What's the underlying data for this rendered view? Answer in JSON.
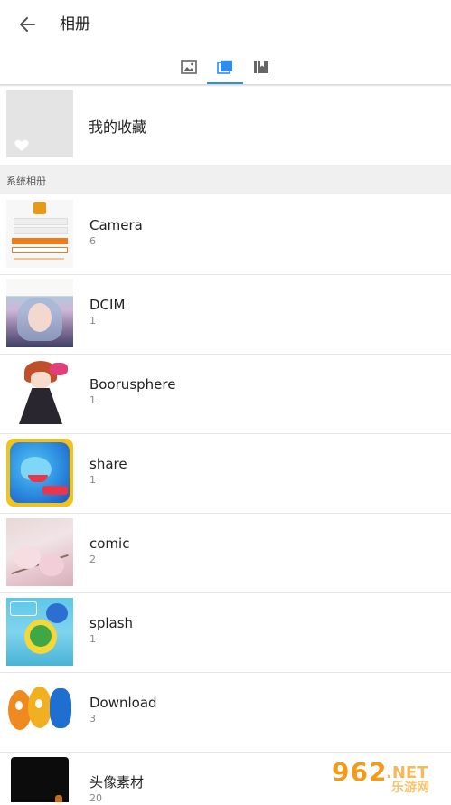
{
  "header": {
    "title": "相册"
  },
  "tabs": [
    {
      "icon": "image-icon",
      "active": false
    },
    {
      "icon": "album-icon",
      "active": true
    },
    {
      "icon": "bookmark-icon",
      "active": false
    }
  ],
  "favorites": {
    "label": "我的收藏"
  },
  "section": {
    "label": "系统相册"
  },
  "albums": [
    {
      "name": "Camera",
      "count": "6"
    },
    {
      "name": "DCIM",
      "count": "1"
    },
    {
      "name": "Boorusphere",
      "count": "1"
    },
    {
      "name": "share",
      "count": "1"
    },
    {
      "name": "comic",
      "count": "2"
    },
    {
      "name": "splash",
      "count": "1"
    },
    {
      "name": "Download",
      "count": "3"
    },
    {
      "name": "头像素材",
      "count": "20"
    }
  ],
  "watermark": {
    "main": "962",
    "net": ".NET",
    "sub": "乐游网"
  },
  "colors": {
    "accent": "#2d8cf0",
    "tab_inactive": "#666666",
    "section_bg": "#f0f0f0"
  }
}
